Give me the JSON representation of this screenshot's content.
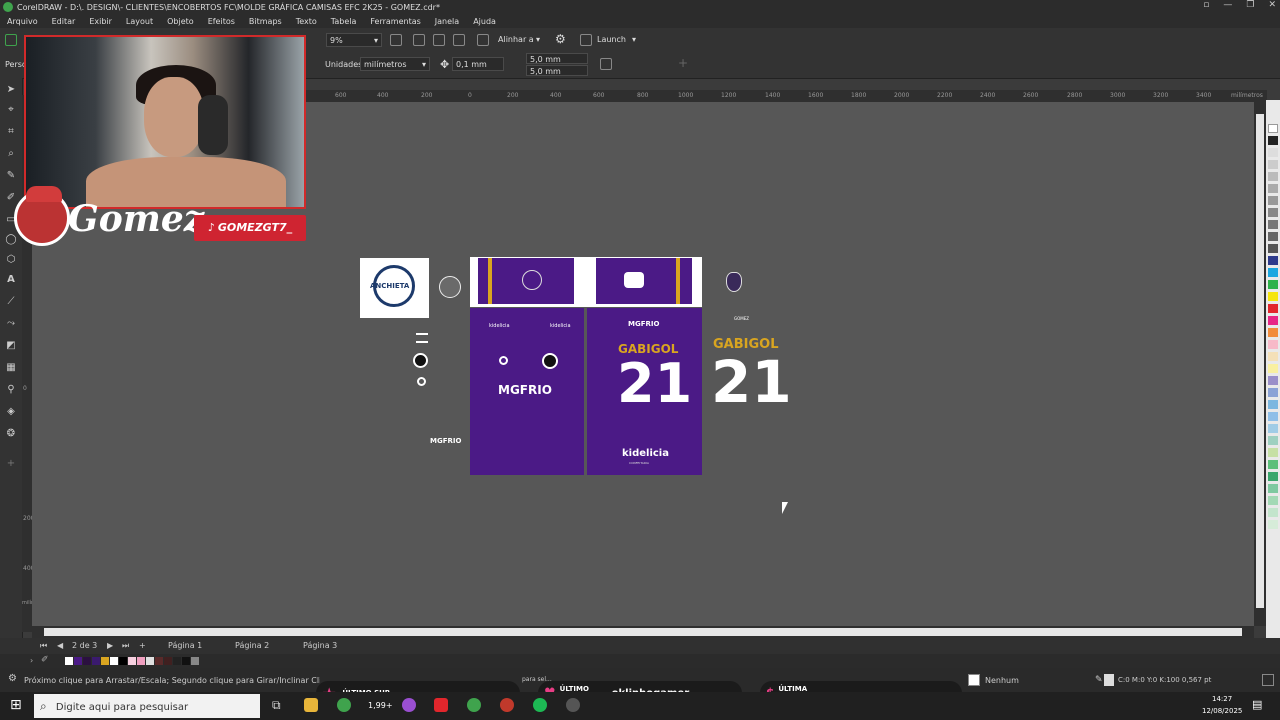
{
  "window": {
    "title": "CorelDRAW - D:\\. DESIGN\\- CLIENTES\\ENCOBERTOS FC\\MOLDE GRÁFICA CAMISAS EFC 2K25 - GOMEZ.cdr*"
  },
  "menu": [
    "Arquivo",
    "Editar",
    "Exibir",
    "Layout",
    "Objeto",
    "Efeitos",
    "Bitmaps",
    "Texto",
    "Tabela",
    "Ferramentas",
    "Janela",
    "Ajuda"
  ],
  "toolbar": {
    "zoom": "9%",
    "align_label": "Alinhar a",
    "launch_label": "Launch"
  },
  "propbar": {
    "preset_label": "Perso",
    "units_label": "Unidades:",
    "units_value": "milímetros",
    "nudge": "0,1 mm",
    "dup_x": "5,0 mm",
    "dup_y": "5,0 mm"
  },
  "ruler": {
    "ticks": [
      "600",
      "400",
      "200",
      "0",
      "200",
      "400",
      "600",
      "800",
      "1000",
      "1200",
      "1400",
      "1600",
      "1800",
      "2000",
      "2200",
      "2400",
      "2600",
      "2800",
      "3000",
      "3200",
      "3400"
    ],
    "unit": "milímetros",
    "vunit": "milímetros",
    "vticks": [
      "200",
      "0",
      "200",
      "400"
    ]
  },
  "pages": {
    "count": "2 de 3",
    "tabs": [
      "Página 1",
      "Página 2",
      "Página 3"
    ]
  },
  "status": {
    "hint": "Próximo clique para Arrastar/Escala; Segundo clique para Girar/Inclinar Clique dupl...",
    "hint_tail": "para sel...",
    "fill": "Nenhum",
    "outline": "C:0 M:0 Y:0 K:100  0,567 pt"
  },
  "overlay": {
    "tiktok": "GOMEZGT7_",
    "logo_text": "Gomez",
    "last_sub": "ÚLTIMO SUB",
    "last_follow": "ÚLTIMO FOLLOW",
    "follow_name": "oklinhogamer",
    "last_donate": "ÚLTIMA DONATE"
  },
  "design": {
    "club": "ANCHIETA",
    "sponsor": "MGFRIO",
    "sponsor_small": "kidelicia",
    "back_sponsor": "kidelicia",
    "back_sponsor_sub": "CONFEITARIA",
    "player": "GABIGOL",
    "number": "21",
    "small_label": "GOMEZ",
    "side_sponsor": "MGFRIO"
  },
  "taskbar": {
    "search_placeholder": "Digite aqui para pesquisar",
    "time": "14:27",
    "date": "12/08/2025",
    "price": "1,99+"
  },
  "colors": {
    "jersey": "#4b1a86",
    "gold": "#d9a520",
    "accent_red": "#cf2431"
  }
}
